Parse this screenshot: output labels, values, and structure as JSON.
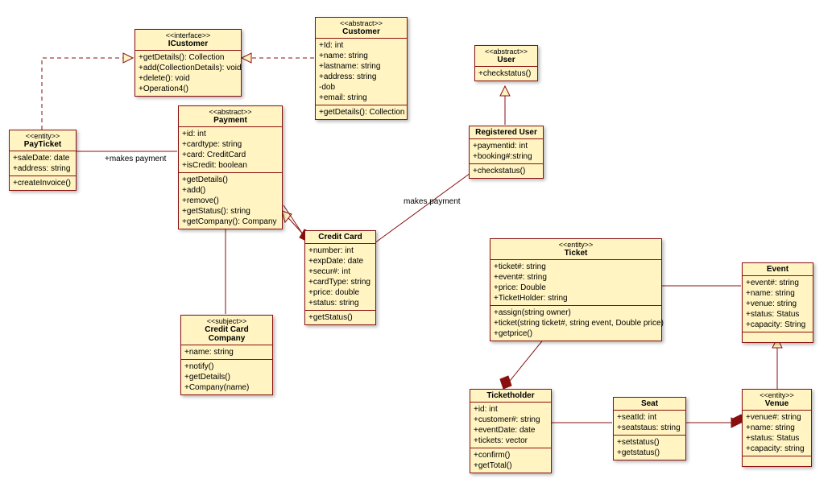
{
  "chart_data": {
    "type": "uml_class_diagram",
    "classes": [
      {
        "id": "ICustomer",
        "stereotype": "<<interface>>",
        "name": "ICustomer",
        "attributes": [],
        "operations": [
          "+getDetails(): Collection",
          "+add(CollectionDetails): void",
          "+delete(): void",
          "+Operation4()"
        ]
      },
      {
        "id": "Customer",
        "stereotype": "<<abstract>>",
        "name": "Customer",
        "attributes": [
          "+Id: int",
          "+name: string",
          "+lastname: string",
          "+address: string",
          "-dob",
          "+email: string"
        ],
        "operations": [
          "+getDetails(): Collection"
        ]
      },
      {
        "id": "User",
        "stereotype": "<<abstract>>",
        "name": "User",
        "attributes": [],
        "operations": [
          "+checkstatus()"
        ]
      },
      {
        "id": "PayTicket",
        "stereotype": "<<entity>>",
        "name": "PayTicket",
        "attributes": [
          "+saleDate: date",
          "+address: string"
        ],
        "operations": [
          "+createInvoice()"
        ]
      },
      {
        "id": "Payment",
        "stereotype": "<<abstract>>",
        "name": "Payment",
        "attributes": [
          "+id: int",
          "+cardtype: string",
          "+card: CreditCard",
          "+isCredit: boolean"
        ],
        "operations": [
          "+getDetails()",
          "+add()",
          "+remove()",
          "+getStatus(): string",
          "+getCompany(): Company"
        ]
      },
      {
        "id": "RegisteredUser",
        "stereotype": "",
        "name": "Registered User",
        "attributes": [
          "+paymentid: int",
          "+booking#:string"
        ],
        "operations": [
          "+checkstatus()"
        ]
      },
      {
        "id": "CreditCard",
        "stereotype": "",
        "name": "Credit Card",
        "attributes": [
          "+number: int",
          "+expDate: date",
          "+secur#: int",
          "+cardType: string",
          "+price: double",
          "+status: string"
        ],
        "operations": [
          "+getStatus()"
        ]
      },
      {
        "id": "CreditCardCompany",
        "stereotype": "<<subject>>",
        "name": "Credit Card Company",
        "attributes": [
          "+name: string"
        ],
        "operations": [
          "+notify()",
          "+getDetails()",
          "+Company(name)"
        ]
      },
      {
        "id": "Ticket",
        "stereotype": "<<entity>>",
        "name": "Ticket",
        "attributes": [
          "+ticket#: string",
          "+event#: string",
          "+price: Double",
          "+TicketHolder: string"
        ],
        "operations": [
          "+assign(string owner)",
          "+ticket(string ticket#, string event, Double price)",
          "+getprice()"
        ]
      },
      {
        "id": "Event",
        "stereotype": "",
        "name": "Event",
        "attributes": [
          "+event#: string",
          "+name: string",
          "+venue: string",
          "+status: Status",
          "+capacity: String"
        ],
        "operations": []
      },
      {
        "id": "Ticketholder",
        "stereotype": "",
        "name": "Ticketholder",
        "attributes": [
          "+id: int",
          "+customer#: string",
          "+eventDate: date",
          "+tickets: vector"
        ],
        "operations": [
          "+confirm()",
          "+getTotal()"
        ]
      },
      {
        "id": "Seat",
        "stereotype": "",
        "name": "Seat",
        "attributes": [
          "+seatId: int",
          "+seatstaus: string"
        ],
        "operations": [
          "+setstatus()",
          "+getstatus()"
        ]
      },
      {
        "id": "Venue",
        "stereotype": "<<entity>>",
        "name": "Venue",
        "attributes": [
          "+venue#: string",
          "+name: string",
          "+status: Status",
          "+capacity: string"
        ],
        "operations": []
      }
    ],
    "relationships": [
      {
        "from": "PayTicket",
        "to": "ICustomer",
        "type": "realization"
      },
      {
        "from": "Customer",
        "to": "ICustomer",
        "type": "realization"
      },
      {
        "from": "PayTicket",
        "to": "Payment",
        "type": "association",
        "label": "+makes payment"
      },
      {
        "from": "CreditCard",
        "to": "Payment",
        "type": "generalization"
      },
      {
        "from": "CreditCardCompany",
        "to": "Payment",
        "type": "generalization"
      },
      {
        "from": "Payment",
        "to": "CreditCard",
        "type": "composition"
      },
      {
        "from": "RegisteredUser",
        "to": "User",
        "type": "generalization"
      },
      {
        "from": "RegisteredUser",
        "to": "CreditCard",
        "type": "association",
        "label": "makes payment"
      },
      {
        "from": "Ticket",
        "to": "Event",
        "type": "association"
      },
      {
        "from": "Ticket",
        "to": "Ticketholder",
        "type": "composition"
      },
      {
        "from": "Ticketholder",
        "to": "Seat",
        "type": "association"
      },
      {
        "from": "Seat",
        "to": "Venue",
        "type": "composition"
      },
      {
        "from": "Venue",
        "to": "Event",
        "type": "generalization"
      }
    ]
  },
  "labels": {
    "makes_payment_1": "+makes payment",
    "makes_payment_2": "makes payment"
  }
}
